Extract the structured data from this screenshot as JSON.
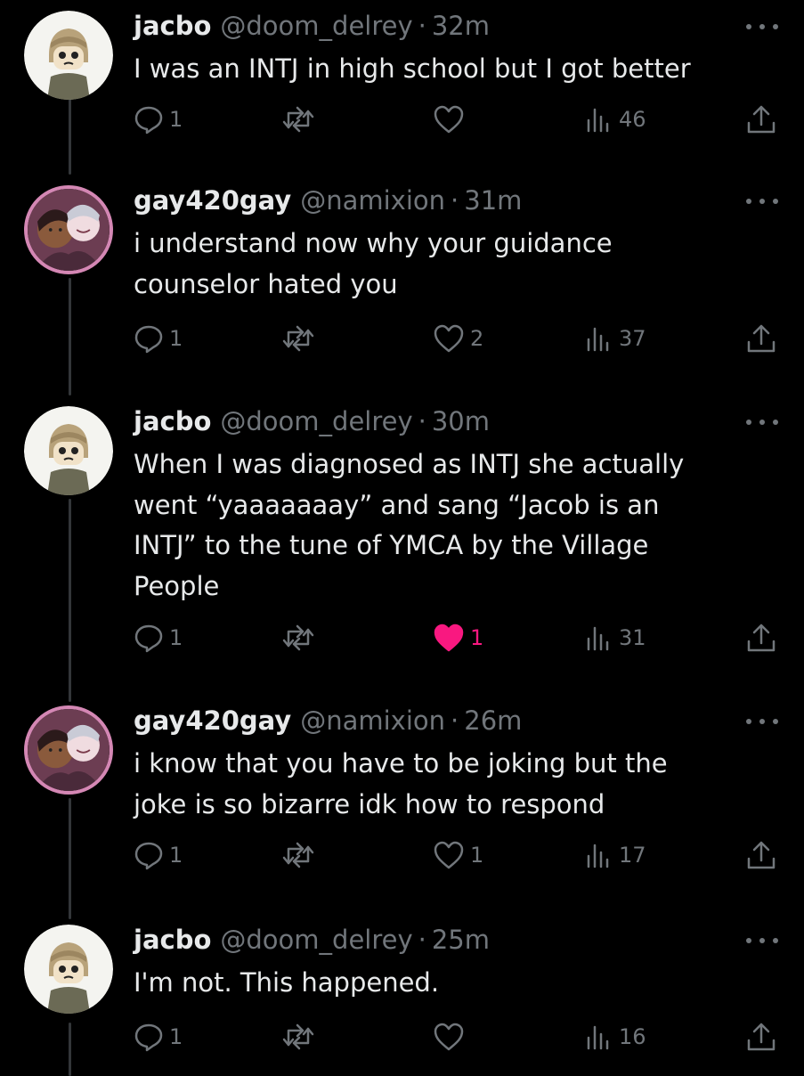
{
  "colors": {
    "background": "#000000",
    "text": "#e7e9ea",
    "muted": "#71767b",
    "like_active": "#f91880",
    "thread_line": "#333639"
  },
  "icons": {
    "reply": "reply-bubble-icon",
    "retweet": "retweet-arrows-icon",
    "like": "heart-icon",
    "views": "bar-chart-icon",
    "share": "share-arrow-icon",
    "more": "more-dots-icon"
  },
  "tweets": [
    {
      "name": "jacbo",
      "handle": "@doom_delrey",
      "sep": "·",
      "time": "32m",
      "text": "I was an INTJ in high school but I got better",
      "replies": "1",
      "retweets": "",
      "likes": "",
      "liked": false,
      "views": "46"
    },
    {
      "name": "gay420gay",
      "handle": "@namixion",
      "sep": "·",
      "time": "31m",
      "text": "i understand now why your guidance\ncounselor hated you",
      "replies": "1",
      "retweets": "",
      "likes": "2",
      "liked": false,
      "views": "37"
    },
    {
      "name": "jacbo",
      "handle": "@doom_delrey",
      "sep": "·",
      "time": "30m",
      "text": "When I was diagnosed as INTJ she actually\nwent “yaaaaaaay” and sang “Jacob is an\nINTJ” to the tune of YMCA by the Village\nPeople",
      "replies": "1",
      "retweets": "",
      "likes": "1",
      "liked": true,
      "views": "31"
    },
    {
      "name": "gay420gay",
      "handle": "@namixion",
      "sep": "·",
      "time": "26m",
      "text": "i know that you have to be joking but the\njoke is so bizarre idk how to respond",
      "replies": "1",
      "retweets": "",
      "likes": "1",
      "liked": false,
      "views": "17"
    },
    {
      "name": "jacbo",
      "handle": "@doom_delrey",
      "sep": "·",
      "time": "25m",
      "text": "I'm not. This happened.",
      "replies": "1",
      "retweets": "",
      "likes": "",
      "liked": false,
      "views": "16"
    }
  ]
}
